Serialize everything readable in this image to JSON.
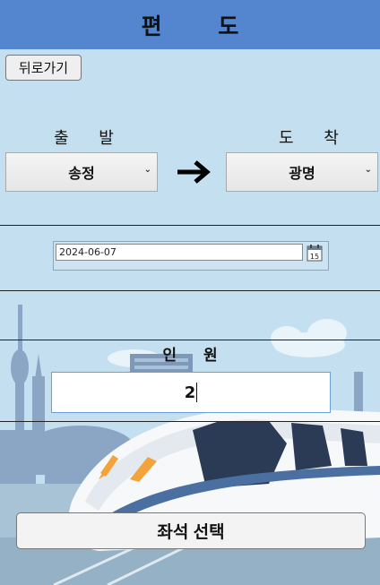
{
  "header": {
    "title": "편 도"
  },
  "back_button": {
    "label": "뒤로가기"
  },
  "route": {
    "departure_label": "출 발",
    "arrival_label": "도 착",
    "departure_value": "송정",
    "arrival_value": "광명",
    "arrow_icon": "right-arrow-icon",
    "dropdown_icon": "chevron-down-icon"
  },
  "date": {
    "value": "2024-06-07",
    "calendar_icon": "calendar-icon",
    "calendar_day": "15"
  },
  "people": {
    "label": "인 원",
    "value": "2"
  },
  "seat_button": {
    "label": "좌석 선택"
  },
  "colors": {
    "header": "#5486cf",
    "sky": "#c3dff0",
    "train_accent": "#f3a33a"
  }
}
